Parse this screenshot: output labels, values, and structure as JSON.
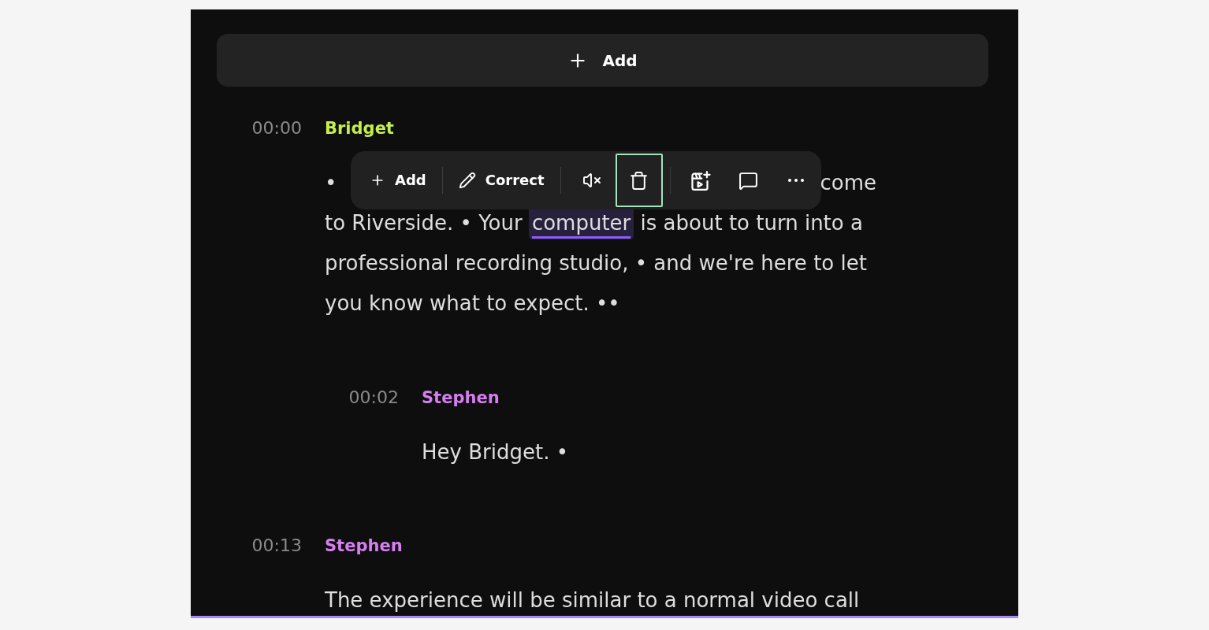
{
  "add_bar": {
    "label": "Add"
  },
  "segments": [
    {
      "time": "00:00",
      "speaker": "Bridget",
      "color": "#c5ef4f",
      "covered_line": {
        "start": "•",
        "end": "come"
      },
      "text": [
        {
          "text": "to Riverside. • Your ",
          "selected": false
        },
        {
          "text": "computer",
          "selected": true
        },
        {
          "text": " is about to turn into a professional recording studio, • and we're here to let you know what to expect. ••",
          "selected": false
        }
      ],
      "toolbar": {
        "groups": [
          [
            {
              "kind": "text",
              "label": "Add",
              "focused": false
            }
          ],
          [
            {
              "kind": "text",
              "label": "Correct",
              "focused": false
            }
          ],
          [
            {
              "kind": "icon",
              "focused": false
            },
            {
              "kind": "icon",
              "focused": true
            }
          ],
          [
            {
              "kind": "icon",
              "focused": false
            },
            {
              "kind": "icon",
              "focused": false
            },
            {
              "kind": "icon",
              "focused": false
            }
          ]
        ]
      },
      "children": [
        {
          "time": "00:02",
          "speaker": "Stephen",
          "color": "#d77ef1",
          "text": [
            {
              "text": "Hey Bridget. •",
              "selected": false
            }
          ]
        }
      ]
    },
    {
      "time": "00:13",
      "speaker": "Stephen",
      "color": "#d77ef1",
      "text": [
        {
          "text": "The experience will be similar to a normal video call",
          "selected": false
        }
      ]
    }
  ]
}
